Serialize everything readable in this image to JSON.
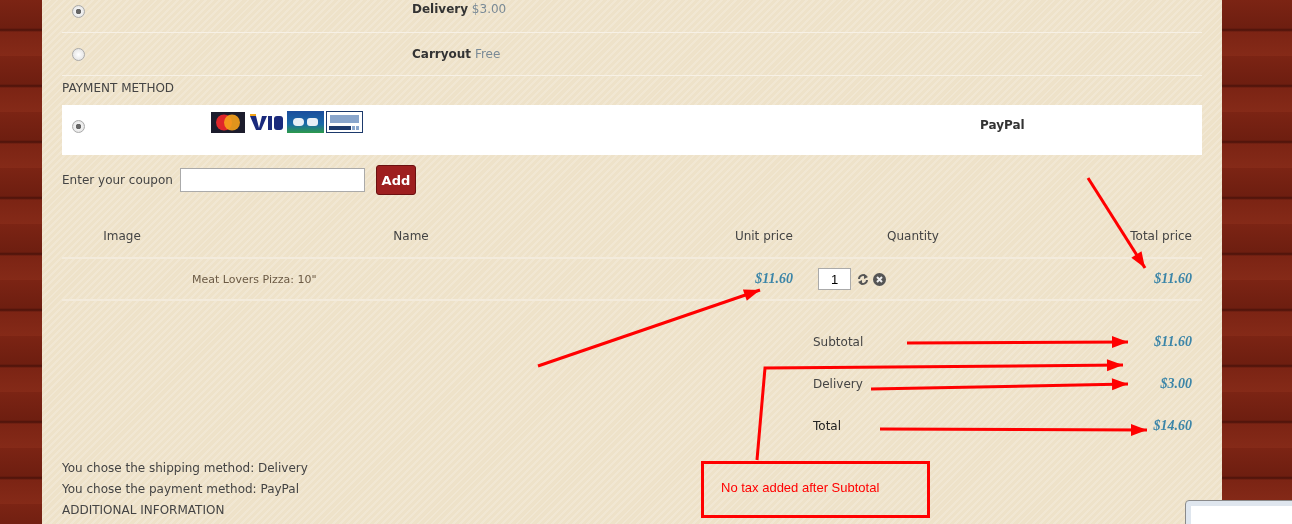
{
  "shipping_methods": [
    {
      "name": "Delivery",
      "price": "$3.00",
      "selected": true
    },
    {
      "name": "Carryout",
      "price": "Free",
      "selected": false
    }
  ],
  "payment_section": {
    "title": "PAYMENT METHOD",
    "methods": [
      {
        "name": "PayPal",
        "selected": true
      }
    ]
  },
  "coupon": {
    "label": "Enter your coupon",
    "button": "Add"
  },
  "cart": {
    "columns": [
      "Image",
      "Name",
      "Unit price",
      "Quantity",
      "Total price"
    ],
    "rows": [
      {
        "name": "Meat Lovers Pizza: 10\"",
        "unit_price": "$11.60",
        "quantity": "1",
        "total_price": "$11.60"
      }
    ]
  },
  "summary": [
    {
      "label": "Subtotal",
      "value": "$11.60"
    },
    {
      "label": "Delivery",
      "value": "$3.00"
    },
    {
      "label": "Total",
      "value": "$14.60"
    }
  ],
  "confirmations": [
    "You chose the shipping method: Delivery",
    "You chose the payment method: PayPal"
  ],
  "section_heading": "ADDITIONAL INFORMATION",
  "annotation": {
    "note": "No tax added after Subtotal"
  }
}
